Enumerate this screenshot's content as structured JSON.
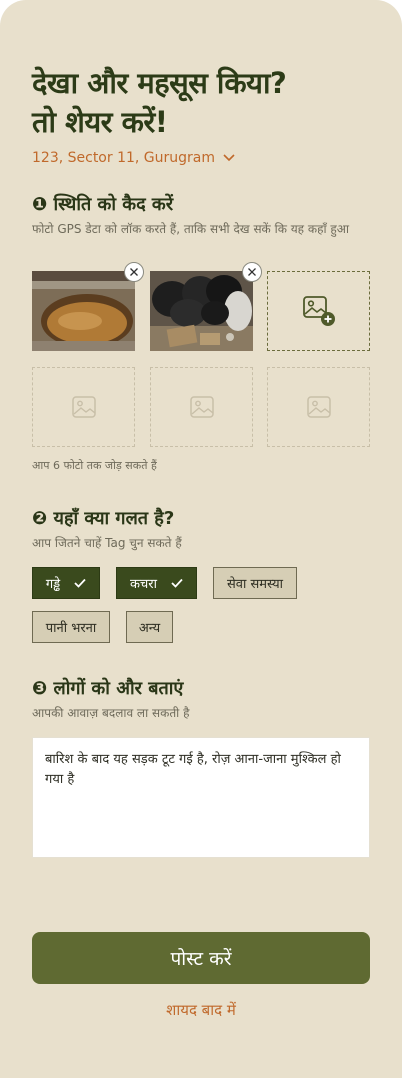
{
  "header": {
    "title_line1": "देखा और महसूस किया?",
    "title_line2": "तो शेयर करें!",
    "location": "123, Sector 11, Gurugram"
  },
  "section1": {
    "title": "❶ स्थिति को कैद करें",
    "subtitle": "फोटो GPS डेटा को लॉक करते हैं, ताकि सभी देख सकें कि यह कहाँ हुआ",
    "photos": [
      {
        "icon": "pothole-photo"
      },
      {
        "icon": "garbage-bags-photo"
      }
    ],
    "hint": "आप 6 फोटो तक जोड़ सकते हैं"
  },
  "section2": {
    "title": "❷ यहाँ क्या गलत है?",
    "subtitle": "आप जितने चाहें Tag चुन सकते हैं",
    "tags": [
      {
        "label": "गड्ढे",
        "selected": true
      },
      {
        "label": "कचरा",
        "selected": true
      },
      {
        "label": "सेवा समस्या",
        "selected": false
      },
      {
        "label": "पानी भरना",
        "selected": false
      },
      {
        "label": "अन्य",
        "selected": false
      }
    ]
  },
  "section3": {
    "title": "❸ लोगों को और बताएं",
    "subtitle": "आपकी आवाज़ बदलाव ला सकती है",
    "description": "बारिश के बाद यह सड़क टूट गई है, रोज़ आना-जाना मुश्किल हो गया है"
  },
  "actions": {
    "post_label": "पोस्ट करें",
    "later_label": "शायद बाद में"
  },
  "colors": {
    "background": "#e8e0cc",
    "title": "#2c3b17",
    "accent": "#c0692b",
    "chip_selected": "#3a4a1d",
    "chip_unselected": "#d6ceb5",
    "button": "#5f6a32"
  }
}
